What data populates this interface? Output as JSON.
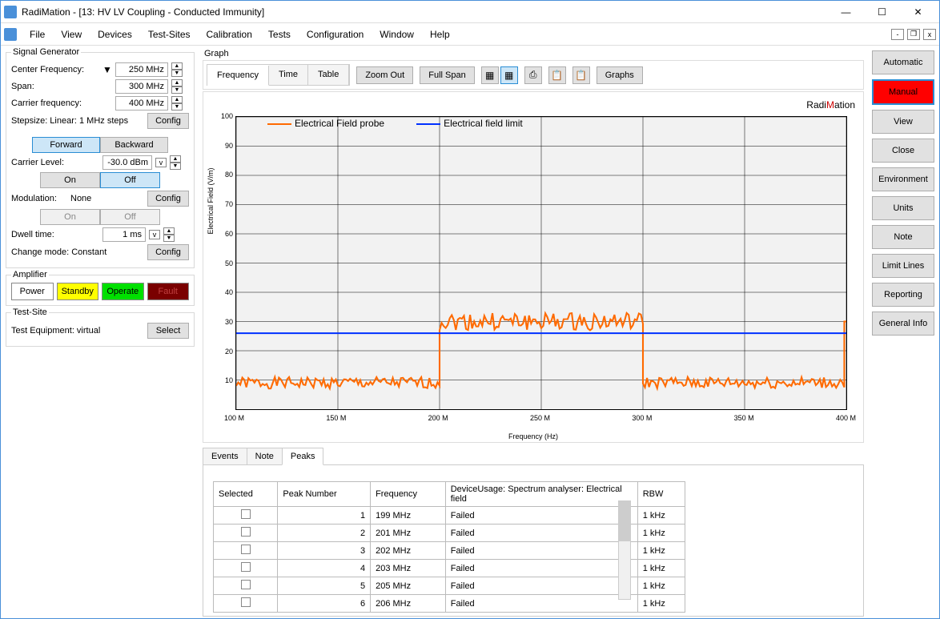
{
  "window": {
    "title": "RadiMation - [13: HV LV Coupling - Conducted Immunity]"
  },
  "menu": {
    "items": [
      "File",
      "View",
      "Devices",
      "Test-Sites",
      "Calibration",
      "Tests",
      "Configuration",
      "Window",
      "Help"
    ]
  },
  "sig_gen": {
    "legend": "Signal Generator",
    "center_freq_lbl": "Center Frequency:",
    "center_freq": "250 MHz",
    "span_lbl": "Span:",
    "span": "300 MHz",
    "carrier_freq_lbl": "Carrier frequency:",
    "carrier_freq": "400 MHz",
    "stepsize_lbl": "Stepsize: Linear: 1 MHz steps",
    "config": "Config",
    "forward": "Forward",
    "backward": "Backward",
    "carrier_level_lbl": "Carrier Level:",
    "carrier_level": "-30.0 dBm",
    "on": "On",
    "off": "Off",
    "modulation_lbl": "Modulation:",
    "modulation_val": "None",
    "dwell_lbl": "Dwell time:",
    "dwell": "1 ms",
    "change_mode_lbl": "Change mode: Constant"
  },
  "amp": {
    "legend": "Amplifier",
    "power": "Power",
    "standby": "Standby",
    "operate": "Operate",
    "fault": "Fault"
  },
  "testsite": {
    "legend": "Test-Site",
    "equip_lbl": "Test Equipment: virtual",
    "select": "Select"
  },
  "graph": {
    "legend": "Graph",
    "tabs": [
      "Frequency",
      "Time",
      "Table"
    ],
    "zoom_out": "Zoom Out",
    "full_span": "Full Span",
    "graphs_btn": "Graphs",
    "brand_a": "Radi",
    "brand_b": "M",
    "brand_c": "ation",
    "legend_probe": "Electrical Field probe",
    "legend_limit": "Electrical field limit",
    "ylabel": "Electrical Field (V/m)",
    "xlabel": "Frequency (Hz)"
  },
  "right": {
    "automatic": "Automatic",
    "manual": "Manual",
    "view": "View",
    "close": "Close",
    "environment": "Environment",
    "units": "Units",
    "note": "Note",
    "limit": "Limit Lines",
    "reporting": "Reporting",
    "general": "General Info"
  },
  "bottom": {
    "tabs": [
      "Events",
      "Note",
      "Peaks"
    ],
    "headers": {
      "sel": "Selected",
      "pn": "Peak Number",
      "freq": "Frequency",
      "dev": "DeviceUsage: Spectrum analyser: Electrical field",
      "rbw": "RBW"
    },
    "rows": [
      {
        "pn": "1",
        "freq": "199 MHz",
        "dev": "Failed",
        "rbw": "1 kHz"
      },
      {
        "pn": "2",
        "freq": "201 MHz",
        "dev": "Failed",
        "rbw": "1 kHz"
      },
      {
        "pn": "3",
        "freq": "202 MHz",
        "dev": "Failed",
        "rbw": "1 kHz"
      },
      {
        "pn": "4",
        "freq": "203 MHz",
        "dev": "Failed",
        "rbw": "1 kHz"
      },
      {
        "pn": "5",
        "freq": "205 MHz",
        "dev": "Failed",
        "rbw": "1 kHz"
      },
      {
        "pn": "6",
        "freq": "206 MHz",
        "dev": "Failed",
        "rbw": "1 kHz"
      }
    ]
  },
  "chart_data": {
    "type": "line",
    "xlabel": "Frequency (Hz)",
    "ylabel": "Electrical Field (V/m)",
    "xlim": [
      100,
      400
    ],
    "ylim": [
      0,
      100
    ],
    "x_ticks": [
      "100 M",
      "150 M",
      "200 M",
      "250 M",
      "300 M",
      "350 M",
      "400 M"
    ],
    "y_ticks": [
      10,
      20,
      30,
      40,
      50,
      60,
      70,
      80,
      90,
      100
    ],
    "series": [
      {
        "name": "Electrical Field probe",
        "color": "#ff6a00",
        "segments": [
          {
            "x0": 100,
            "x1": 200,
            "y": 9,
            "jitter": 2
          },
          {
            "x0": 200,
            "x1": 300,
            "y": 30,
            "jitter": 3
          },
          {
            "x0": 300,
            "x1": 399,
            "y": 9,
            "jitter": 2
          },
          {
            "x0": 399,
            "x1": 400,
            "y": 30,
            "jitter": 0
          }
        ]
      },
      {
        "name": "Electrical field limit",
        "color": "#0030ff",
        "segments": [
          {
            "x0": 100,
            "x1": 400,
            "y": 26,
            "jitter": 0
          }
        ]
      }
    ]
  }
}
